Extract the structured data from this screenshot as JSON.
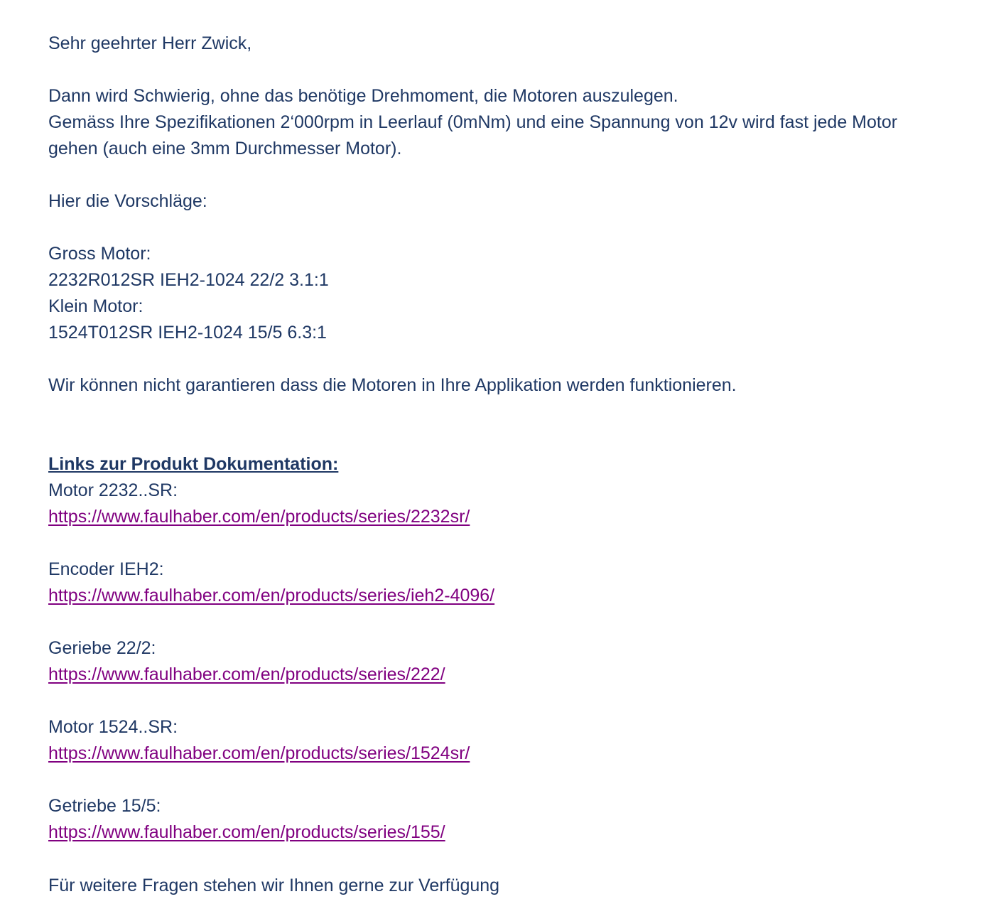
{
  "email": {
    "greeting": "Sehr geehrter Herr Zwick,",
    "paragraph1": [
      "Dann wird Schwierig, ohne das benötige Drehmoment,  die Motoren auszulegen.",
      "Gemäss Ihre Spezifikationen 2‘000rpm in Leerlauf (0mNm) und eine Spannung von 12v wird fast jede Motor",
      "gehen (auch eine 3mm Durchmesser Motor)."
    ],
    "suggestions_intro": "Hier die Vorschläge:",
    "suggestions": [
      "Gross Motor:",
      "2232R012SR IEH2-1024 22/2 3.1:1",
      "Klein Motor:",
      "1524T012SR IEH2-1024 15/5 6.3:1"
    ],
    "disclaimer": "Wir können nicht garantieren dass die Motoren in Ihre Applikation werden funktionieren.",
    "links_heading": "Links zur Produkt Dokumentation:",
    "links": [
      {
        "label": "Motor 2232..SR:",
        "url": "https://www.faulhaber.com/en/products/series/2232sr/"
      },
      {
        "label": "Encoder IEH2:",
        "url": "https://www.faulhaber.com/en/products/series/ieh2-4096/"
      },
      {
        "label": "Geriebe 22/2:",
        "url": "https://www.faulhaber.com/en/products/series/222/"
      },
      {
        "label": "Motor 1524..SR:",
        "url": "https://www.faulhaber.com/en/products/series/1524sr/"
      },
      {
        "label": "Getriebe 15/5:",
        "url": "https://www.faulhaber.com/en/products/series/155/"
      }
    ],
    "closing_partial": "Für weitere Fragen stehen wir Ihnen gerne zur Verfügung"
  },
  "colors": {
    "text": "#1f3864",
    "link": "#800080",
    "background": "#ffffff"
  }
}
